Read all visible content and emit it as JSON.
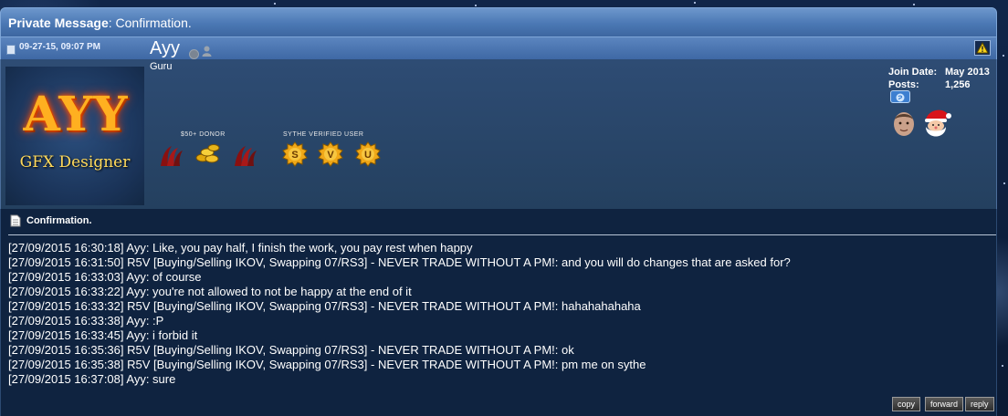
{
  "window": {
    "title_bold": "Private Message",
    "title_rest": ": Confirmation."
  },
  "post": {
    "date": "09-27-15, 09:07 PM",
    "warn_icon": "warning-triangle-icon"
  },
  "user": {
    "avatar_line1": "AYY",
    "avatar_line2": "GFX Designer",
    "name": "Ayy",
    "title": "Guru",
    "join_label": "Join Date:",
    "join_value": "May 2013",
    "posts_label": "Posts:",
    "posts_value": "1,256",
    "awards": {
      "donor_caption": "$50+ DONOR",
      "verified_caption": "SYTHE VERIFIED USER",
      "verified_letters": [
        "S",
        "V",
        "U"
      ]
    }
  },
  "message": {
    "title": "Confirmation.",
    "lines": [
      "[27/09/2015 16:30:18] Ayy: Like, you pay half, I finish the work, you pay rest when happy",
      "[27/09/2015 16:31:50] R5V [Buying/Selling IKOV, Swapping 07/RS3] - NEVER TRADE WITHOUT A PM!: and you will do changes that are asked for?",
      "[27/09/2015 16:33:03] Ayy: of course",
      "[27/09/2015 16:33:22] Ayy: you're not allowed to not be happy at the end of it",
      "[27/09/2015 16:33:32] R5V [Buying/Selling IKOV, Swapping 07/RS3] - NEVER TRADE WITHOUT A PM!: hahahahahaha",
      "[27/09/2015 16:33:38] Ayy: :P",
      "[27/09/2015 16:33:45] Ayy: i forbid it",
      "[27/09/2015 16:35:36] R5V [Buying/Selling IKOV, Swapping 07/RS3] - NEVER TRADE WITHOUT A PM!: ok",
      "[27/09/2015 16:35:38] R5V [Buying/Selling IKOV, Swapping 07/RS3] - NEVER TRADE WITHOUT A PM!: pm me on sythe",
      "[27/09/2015 16:37:08] Ayy: sure"
    ]
  },
  "buttons": {
    "copy": "copy",
    "forward": "forward",
    "reply": "reply"
  },
  "colors": {
    "title_bar": "#4b78b4",
    "panel": "#2e4c74",
    "content_bg": "#0f2340",
    "avatar_text": "#ffb020"
  }
}
